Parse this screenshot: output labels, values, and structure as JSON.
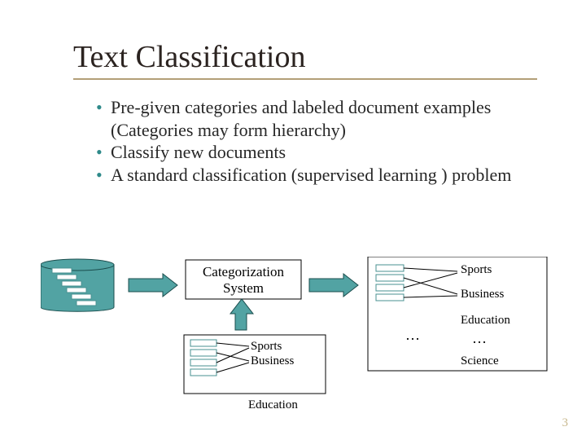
{
  "title": "Text Classification",
  "bullets": [
    "Pre-given categories and labeled document examples (Categories may form hierarchy)",
    "Classify new documents",
    "A standard classification (supervised learning ) problem"
  ],
  "diagram": {
    "system_box": {
      "line1": "Categorization",
      "line2": "System"
    },
    "lower_group": {
      "label1": "Sports",
      "label2": "Business",
      "label3": "Education"
    },
    "right_group": {
      "label1": "Sports",
      "label2": "Business",
      "label3": "Education",
      "label4": "Science",
      "ellipsis1": "…",
      "ellipsis2": "…"
    }
  },
  "page_number": "3"
}
